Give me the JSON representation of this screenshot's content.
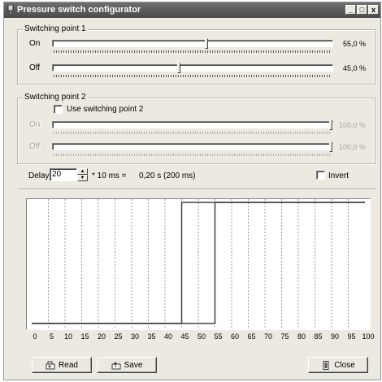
{
  "window": {
    "title": "Pressure switch configurator",
    "min_label": "_",
    "max_label": "□",
    "close_label": "x"
  },
  "sp1": {
    "legend": "Switching point 1",
    "on_label": "On",
    "on_value": "55,0 %",
    "on_percent": 55,
    "off_label": "Off",
    "off_value": "45,0 %",
    "off_percent": 45
  },
  "sp2": {
    "legend": "Switching point 2",
    "use_label": "Use switching point 2",
    "use_checked": false,
    "on_label": "On",
    "on_value": "100,0 %",
    "on_percent": 100,
    "off_label": "Off",
    "off_value": "100,0 %",
    "off_percent": 100
  },
  "delay": {
    "label": "Delay",
    "value": "20",
    "unit_text": "* 10 ms =",
    "result_text": "0,20 s (200 ms)"
  },
  "invert": {
    "label": "Invert",
    "checked": false
  },
  "chart_data": {
    "type": "line",
    "x_ticks": [
      "0",
      "5",
      "10",
      "15",
      "20",
      "25",
      "30",
      "35",
      "40",
      "45",
      "50",
      "55",
      "60",
      "65",
      "70",
      "75",
      "80",
      "85",
      "90",
      "95",
      "100"
    ],
    "xlim": [
      0,
      100
    ],
    "grid": "vertical dashed every 5",
    "series": [
      {
        "values_x": [
          0,
          55,
          55,
          100
        ],
        "values_y": [
          "low",
          "low",
          "high",
          "high"
        ]
      },
      {
        "values_x": [
          0,
          45,
          45,
          100
        ],
        "values_y": [
          "low",
          "low",
          "high",
          "high"
        ]
      }
    ]
  },
  "buttons": {
    "read": "Read",
    "save": "Save",
    "close": "Close"
  },
  "colors": {
    "titlebar": "#5a5a5a",
    "face": "#ece9e0",
    "plot_line": "#404040"
  }
}
